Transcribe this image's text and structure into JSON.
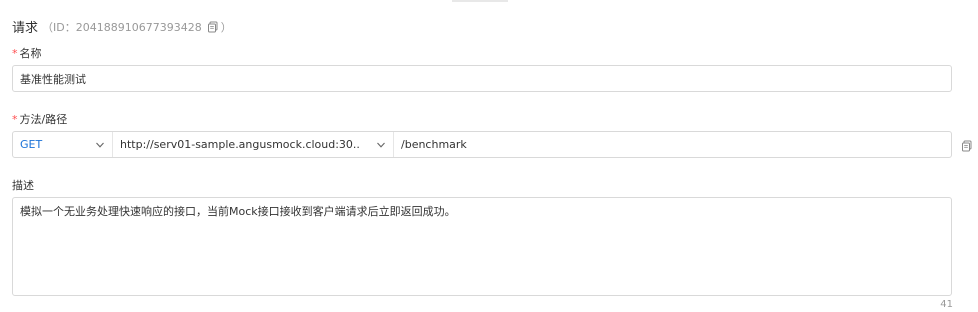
{
  "header": {
    "title": "请求",
    "id_text": "（ID：204188910677393428",
    "id_close": "）"
  },
  "name": {
    "label": "名称",
    "value": "基准性能测试"
  },
  "endpoint": {
    "label": "方法/路径",
    "method": "GET",
    "server": "http://serv01-sample.angusmock.cloud:30...",
    "path": "/benchmark"
  },
  "description": {
    "label": "描述",
    "value": "模拟一个无业务处理快速响应的接口，当前Mock接口接收到客户端请求后立即返回成功。",
    "char_count": "41"
  },
  "required_mark": "*",
  "icons": {
    "copy": "copy-icon",
    "chevron": "chevron-down-icon"
  }
}
